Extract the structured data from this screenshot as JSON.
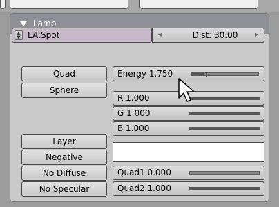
{
  "panel": {
    "title": "Lamp"
  },
  "lamp_browse": {
    "name": "LA:Spot"
  },
  "dist": {
    "label": "Dist: 30.00"
  },
  "buttons": {
    "quad": "Quad",
    "sphere": "Sphere",
    "layer": "Layer",
    "negative": "Negative",
    "no_diffuse": "No Diffuse",
    "no_specular": "No Specular"
  },
  "sliders": {
    "energy": {
      "label": "Energy 1.750",
      "value": 1.75,
      "max": 10
    },
    "r": {
      "label": "R 1.000",
      "value": 1.0,
      "max": 1
    },
    "g": {
      "label": "G 1.000",
      "value": 1.0,
      "max": 1
    },
    "b": {
      "label": "B 1.000",
      "value": 1.0,
      "max": 1
    },
    "quad1": {
      "label": "Quad1 0.000",
      "value": 0.0,
      "max": 1
    },
    "quad2": {
      "label": "Quad2 1.000",
      "value": 1.0,
      "max": 1
    }
  },
  "colors": {
    "header": "#8f8f98",
    "lamp_color": "#ffffff",
    "browse_bg": "#c7bac8"
  },
  "icons": {
    "collapse": "triangle-down-icon",
    "browse": "updown-icon",
    "left_arrow": "arrow-left-icon",
    "right_arrow": "arrow-right-icon",
    "cursor": "mouse-pointer-icon"
  }
}
